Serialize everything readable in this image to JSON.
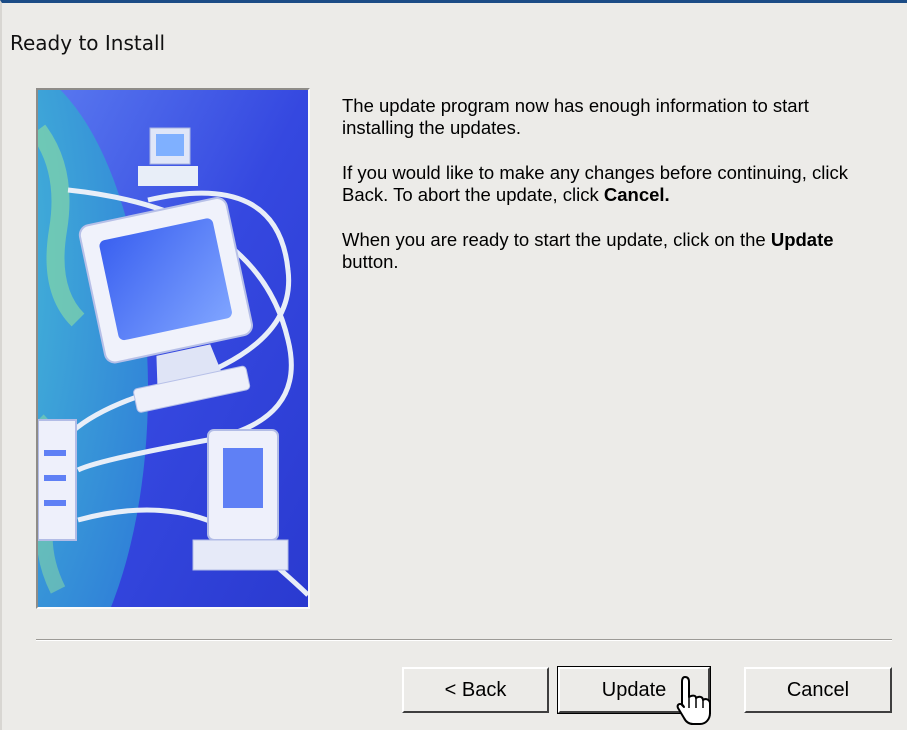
{
  "window": {
    "title": "Ready to Install"
  },
  "content": {
    "paragraph1": "The update program now has enough information to start installing the updates.",
    "paragraph2_part1": "If you would like to make any changes before continuing, click Back. To abort the update, click ",
    "paragraph2_bold": "Cancel.",
    "paragraph3_part1": "When you are ready to start the update, click on the ",
    "paragraph3_bold": "Update",
    "paragraph3_part2": " button."
  },
  "image": {
    "icon": "computer-network-illustration"
  },
  "buttons": {
    "back_label": "< Back",
    "update_label": "Update",
    "cancel_label": "Cancel"
  },
  "colors": {
    "dialog_background": "#ecebe8",
    "illustration_blue": "#3c52e0",
    "title_bar_accent": "#1c4c86"
  }
}
